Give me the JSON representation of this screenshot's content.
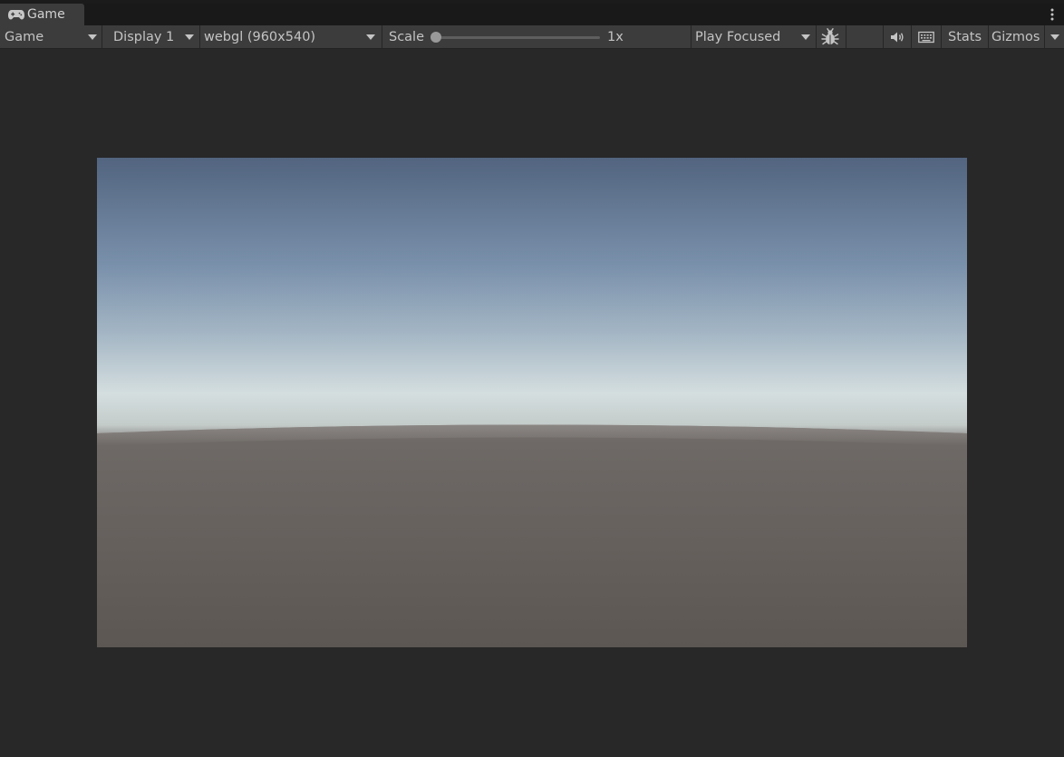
{
  "tab": {
    "title": "Game",
    "icon": "gamepad-icon"
  },
  "toolbar": {
    "view_mode": "Game",
    "display": "Display 1",
    "resolution": "webgl (960x540)",
    "scale_label": "Scale",
    "scale_value": "1x",
    "play_mode": "Play Focused",
    "stats_label": "Stats",
    "gizmos_label": "Gizmos"
  },
  "colors": {
    "panel_bg": "#282828",
    "toolbar_bg": "#3c3c3c",
    "sky_top": "#52647f",
    "horizon": "#d6dfe0",
    "ground": "#6e6966"
  }
}
